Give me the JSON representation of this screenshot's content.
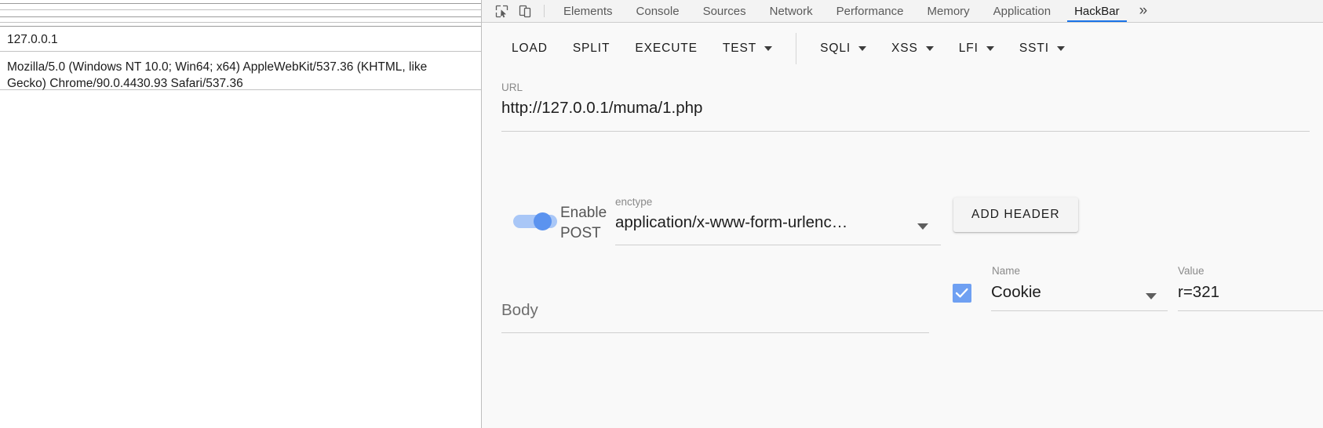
{
  "page": {
    "host": "127.0.0.1",
    "user_agent": "Mozilla/5.0 (Windows NT 10.0; Win64; x64) AppleWebKit/537.36 (KHTML, like Gecko) Chrome/90.0.4430.93 Safari/537.36"
  },
  "devtools": {
    "icons": {
      "inspect": "inspect-element-icon",
      "device": "device-toolbar-icon"
    },
    "tabs": [
      {
        "label": "Elements",
        "active": false
      },
      {
        "label": "Console",
        "active": false
      },
      {
        "label": "Sources",
        "active": false
      },
      {
        "label": "Network",
        "active": false
      },
      {
        "label": "Performance",
        "active": false
      },
      {
        "label": "Memory",
        "active": false
      },
      {
        "label": "Application",
        "active": false
      },
      {
        "label": "HackBar",
        "active": true
      }
    ],
    "overflow_label": "»",
    "active_tab": "HackBar",
    "accent_color": "#1a73e8"
  },
  "hackbar": {
    "toolbar": {
      "load": "LOAD",
      "split": "SPLIT",
      "execute": "EXECUTE",
      "test": "TEST",
      "sqli": "SQLI",
      "xss": "XSS",
      "lfi": "LFI",
      "ssti": "SSTI"
    },
    "url": {
      "label": "URL",
      "value": "http://127.0.0.1/muma/1.php"
    },
    "post": {
      "toggle_label": "Enable POST",
      "enabled": true,
      "toggle_color": "#5b93ef",
      "enctype_label": "enctype",
      "enctype_value": "application/x-www-form-urlenc…"
    },
    "body": {
      "label": "Body",
      "value": ""
    },
    "headers": {
      "add_button": "ADD HEADER",
      "columns": {
        "name": "Name",
        "value": "Value"
      },
      "rows": [
        {
          "enabled": true,
          "name": "Cookie",
          "value": "r=321"
        }
      ]
    }
  }
}
